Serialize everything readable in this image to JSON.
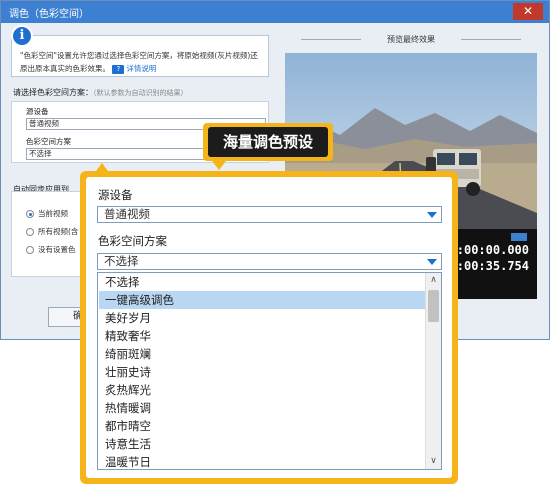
{
  "window": {
    "title": "调色（色彩空间）",
    "close_symbol": "✕"
  },
  "info": {
    "icon_symbol": "i",
    "text": "\"色彩空间\"设置允许您通过选择色彩空间方案，将原始视频(灰片视频)还原出原本真实的色彩效果。",
    "help_badge": "?",
    "help_label": "详情说明"
  },
  "scheme": {
    "heading": "请选择色彩空间方案：",
    "hint": "（默认参数为自动识别的结果）",
    "source_label": "源设备",
    "source_value": "普通视频",
    "colorspace_label": "色彩空间方案",
    "colorspace_value": "不选择"
  },
  "sync": {
    "heading": "自动同步应用到",
    "options": [
      "当前视频",
      "所有视频(含",
      "没有设置色"
    ],
    "selected_index": 0
  },
  "ok_button_label": "确",
  "preview": {
    "title": "预览最终效果",
    "time_current": "00:00:00.000",
    "time_total": "00:00:35.754"
  },
  "callout": {
    "label": "海量调色预设"
  },
  "zoom": {
    "source_label": "源设备",
    "source_value": "普通视频",
    "colorspace_label": "色彩空间方案",
    "colorspace_value": "不选择",
    "options": [
      "不选择",
      "一键高级调色",
      "美好岁月",
      "精致奢华",
      "绮丽斑斓",
      "壮丽史诗",
      "炙热辉光",
      "热情暖调",
      "都市晴空",
      "诗意生活",
      "温暖节日"
    ],
    "highlighted_index": 1,
    "scroll_up_symbol": "∧",
    "scroll_down_symbol": "∨"
  },
  "colors": {
    "accent": "#f5b51a",
    "titlebar": "#3d7fd1",
    "highlight": "#b9d6f2"
  }
}
